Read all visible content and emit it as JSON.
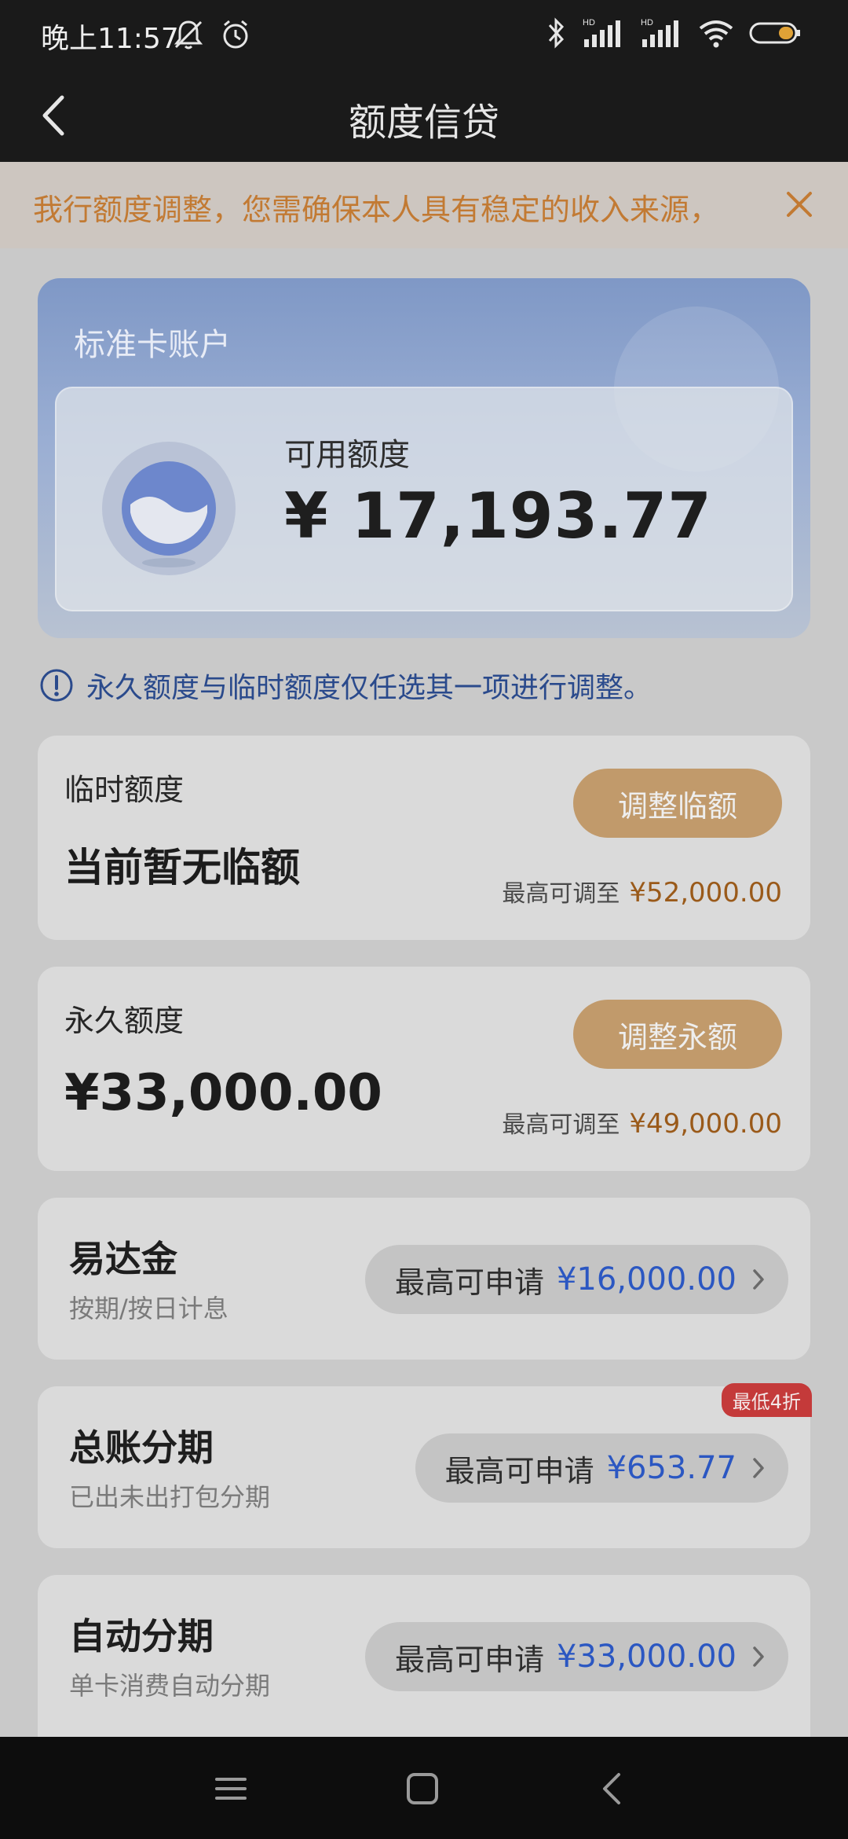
{
  "status_bar": {
    "time": "晚上11:57",
    "left_icons": [
      "bell-off-icon",
      "alarm-icon"
    ],
    "right_icons": [
      "bluetooth-icon",
      "signal-hd-icon",
      "signal-hd-icon",
      "wifi-icon",
      "battery-icon"
    ],
    "hd_label": "HD"
  },
  "nav": {
    "title": "额度信贷",
    "back_icon": "chevron-left-icon"
  },
  "notice": {
    "text": "我行额度调整，您需确保本人具有稳定的收入来源，",
    "close_icon": "close-icon",
    "color": "#c27a33"
  },
  "account": {
    "title": "标准卡账户",
    "available_label": "可用额度",
    "available_value": "¥ 17,193.77",
    "icon": "wallet-logo-icon"
  },
  "tip": {
    "icon": "info-icon",
    "text": "永久额度与临时额度仅任选其一项进行调整。"
  },
  "temp_credit": {
    "label": "临时额度",
    "value": "当前暂无临额",
    "button": "调整临额",
    "max_label": "最高可调至",
    "max_value": "¥52,000.00"
  },
  "perm_credit": {
    "label": "永久额度",
    "value": "¥33,000.00",
    "button": "调整永额",
    "max_label": "最高可调至",
    "max_value": "¥49,000.00"
  },
  "loans": [
    {
      "title": "易达金",
      "subtitle": "按期/按日计息",
      "apply_label": "最高可申请",
      "apply_value": "¥16,000.00",
      "badge": ""
    },
    {
      "title": "总账分期",
      "subtitle": "已出未出打包分期",
      "apply_label": "最高可申请",
      "apply_value": "¥653.77",
      "badge": "最低4折"
    },
    {
      "title": "自动分期",
      "subtitle": "单卡消费自动分期",
      "apply_label": "最高可申请",
      "apply_value": "¥33,000.00",
      "badge": ""
    }
  ],
  "system_nav": {
    "icons": [
      "menu-icon",
      "home-square-icon",
      "back-triangle-icon"
    ]
  },
  "colors": {
    "accent_gold": "#c19a6b",
    "amount_blue": "#2b57c2",
    "amount_brown": "#9a5a1a",
    "badge_red": "#c43a3a"
  }
}
